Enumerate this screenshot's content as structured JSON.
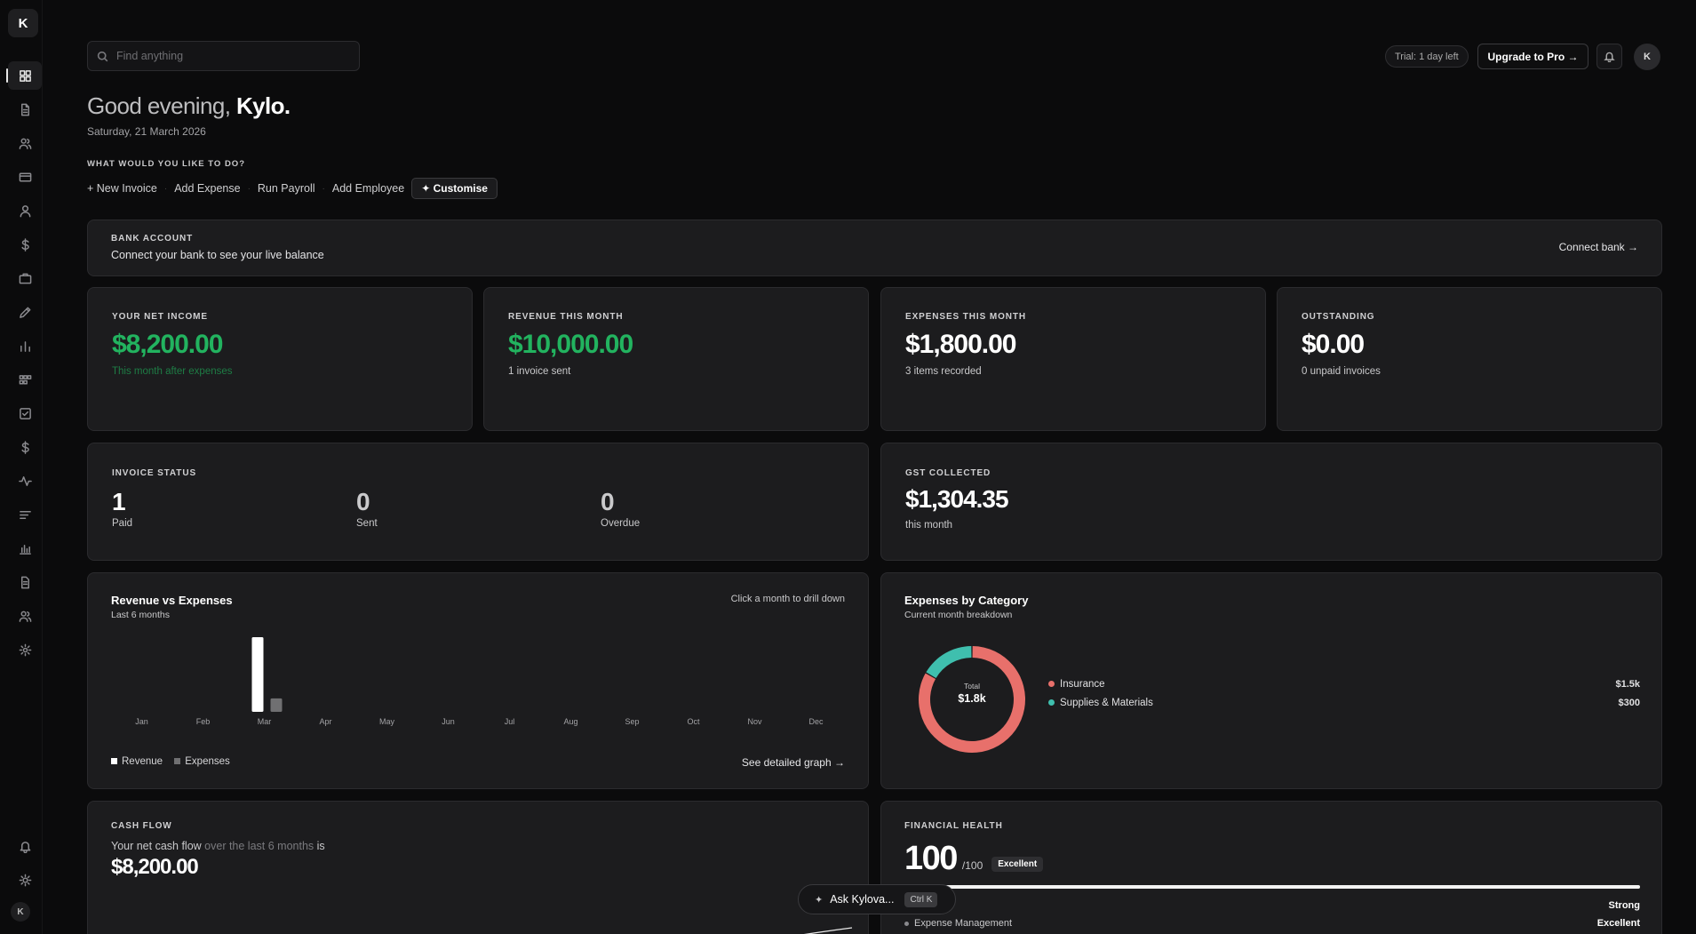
{
  "sidebar": {
    "logo": "K",
    "items": [
      {
        "icon": "dashboard-icon"
      },
      {
        "icon": "invoice-icon"
      },
      {
        "icon": "clients-icon"
      },
      {
        "icon": "card-icon"
      },
      {
        "icon": "user-icon"
      },
      {
        "icon": "dollar-icon"
      },
      {
        "icon": "briefcase-icon"
      },
      {
        "icon": "pen-icon"
      },
      {
        "icon": "bar-chart-icon"
      },
      {
        "icon": "apps-icon"
      },
      {
        "icon": "checklist-icon"
      },
      {
        "icon": "dollar-icon"
      },
      {
        "icon": "activity-icon"
      },
      {
        "icon": "list-icon"
      },
      {
        "icon": "report-icon"
      },
      {
        "icon": "document-icon"
      },
      {
        "icon": "team-icon"
      },
      {
        "icon": "settings-icon"
      }
    ],
    "bottom": {
      "avatar": "K"
    }
  },
  "topbar": {
    "search_placeholder": "Find anything",
    "trial": "Trial: 1 day left",
    "upgrade": "Upgrade to Pro →",
    "avatar": "K"
  },
  "greeting": {
    "prefix": "Good evening,",
    "name": "Kylo.",
    "date": "Saturday, 21 March 2026"
  },
  "quick_actions": {
    "title": "WHAT WOULD YOU LIKE TO DO?",
    "items": [
      "+ New Invoice",
      "Add Expense",
      "Run Payroll",
      "Add Employee"
    ],
    "customise": "✦ Customise"
  },
  "bank": {
    "label": "BANK ACCOUNT",
    "text": "Connect your bank to see your live balance",
    "action": "Connect bank →"
  },
  "kpis": [
    {
      "label": "YOUR NET INCOME",
      "value": "$8,200.00",
      "sub": "This month after expenses"
    },
    {
      "label": "REVENUE THIS MONTH",
      "value": "$10,000.00",
      "sub": "1 invoice sent"
    },
    {
      "label": "EXPENSES THIS MONTH",
      "value": "$1,800.00",
      "sub": "3 items recorded"
    },
    {
      "label": "OUTSTANDING",
      "value": "$0.00",
      "sub": "0 unpaid invoices"
    }
  ],
  "invoice_status": {
    "label": "INVOICE STATUS",
    "items": [
      {
        "value": "1",
        "label": "Paid"
      },
      {
        "value": "0",
        "label": "Sent"
      },
      {
        "value": "0",
        "label": "Overdue"
      }
    ]
  },
  "gst": {
    "label": "GST COLLECTED",
    "value": "$1,304.35",
    "sub": "this month"
  },
  "revenue_chart": {
    "title": "Revenue vs Expenses",
    "subtitle": "Last 6 months",
    "hint": "Click a month to drill down",
    "legend_revenue": "Revenue",
    "legend_expenses": "Expenses",
    "link": "See detailed graph →",
    "colors": {
      "revenue": "#ffffff",
      "expenses": "#707072"
    }
  },
  "expenses_chart": {
    "title": "Expenses by Category",
    "subtitle": "Current month breakdown",
    "total_label": "Total",
    "total_value": "$1.8k",
    "items": [
      {
        "name": "Insurance",
        "amount": "$1.5k",
        "color": "#e8706b"
      },
      {
        "name": "Supplies & Materials",
        "amount": "$300",
        "color": "#3fbfae"
      }
    ]
  },
  "cash_flow": {
    "label": "CASH FLOW",
    "text_a": "Your net cash flow",
    "text_b": "over the last 6 months",
    "text_c": "is",
    "value": "$8,200.00"
  },
  "health": {
    "label": "FINANCIAL HEALTH",
    "score": "100",
    "out_of": "/100",
    "badge": "Excellent",
    "progress": 1.0,
    "rows": [
      {
        "name": "",
        "value": "Strong"
      },
      {
        "name": "Expense Management",
        "value": "Excellent"
      }
    ]
  },
  "ask": {
    "label": "Ask Kylova...",
    "shortcut": "Ctrl K"
  },
  "chart_data": [
    {
      "type": "bar",
      "title": "Revenue vs Expenses",
      "subtitle": "Last 6 months",
      "categories": [
        "Jan",
        "Feb",
        "Mar",
        "Apr",
        "May",
        "Jun",
        "Jul",
        "Aug",
        "Sep",
        "Oct",
        "Nov",
        "Dec"
      ],
      "series": [
        {
          "name": "Revenue",
          "values": [
            0,
            0,
            10000,
            0,
            0,
            0,
            0,
            0,
            0,
            0,
            0,
            0
          ]
        },
        {
          "name": "Expenses",
          "values": [
            0,
            0,
            1800,
            0,
            0,
            0,
            0,
            0,
            0,
            0,
            0,
            0
          ]
        }
      ],
      "ylim": [
        0,
        10000
      ]
    },
    {
      "type": "pie",
      "title": "Expenses by Category",
      "subtitle": "Current month breakdown",
      "categories": [
        "Insurance",
        "Supplies & Materials"
      ],
      "values": [
        1500,
        300
      ]
    }
  ]
}
